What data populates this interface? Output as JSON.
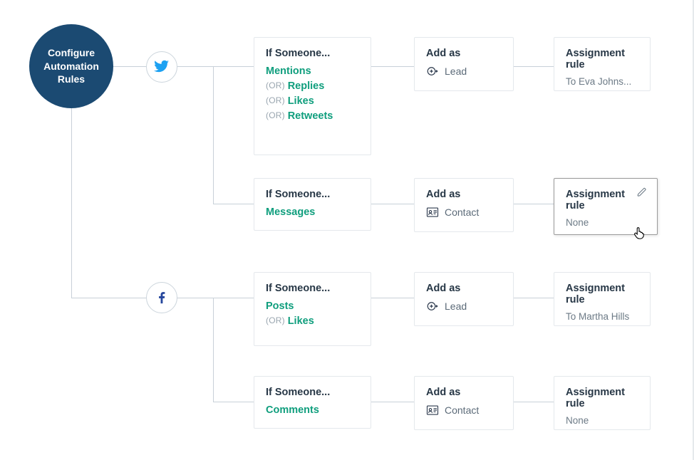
{
  "root": {
    "title_line1": "Configure",
    "title_line2": "Automation",
    "title_line3": "Rules"
  },
  "labels": {
    "if_someone": "If Someone...",
    "add_as": "Add as",
    "assignment_rule": "Assignment rule",
    "or": "(OR)",
    "lead": "Lead",
    "contact": "Contact"
  },
  "channels": {
    "twitter": {
      "name": "twitter"
    },
    "facebook": {
      "name": "facebook"
    }
  },
  "rules": {
    "tw1": {
      "actions": [
        "Mentions",
        "Replies",
        "Likes",
        "Retweets"
      ],
      "add_as": "Lead",
      "assignment": "To Eva Johns..."
    },
    "tw2": {
      "actions": [
        "Messages"
      ],
      "add_as": "Contact",
      "assignment": "None"
    },
    "fb1": {
      "actions": [
        "Posts",
        "Likes"
      ],
      "add_as": "Lead",
      "assignment": "To Martha Hills"
    },
    "fb2": {
      "actions": [
        "Comments"
      ],
      "add_as": "Contact",
      "assignment": "None"
    }
  }
}
